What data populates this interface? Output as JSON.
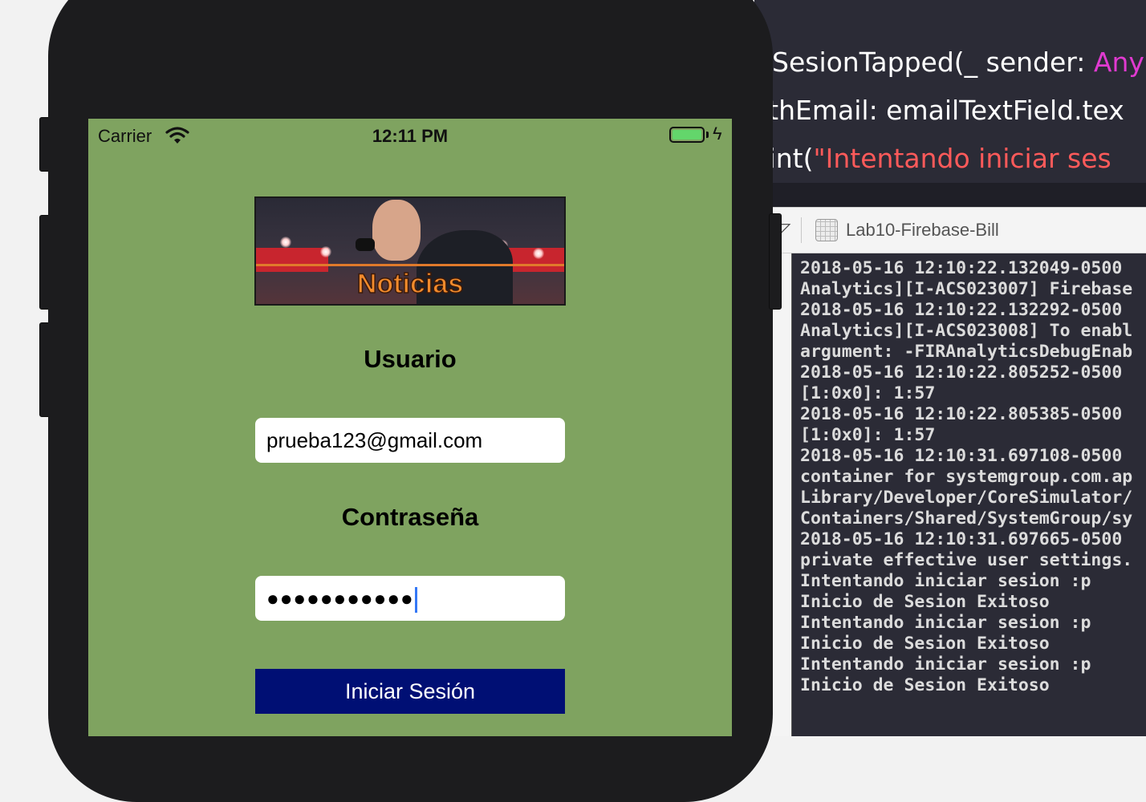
{
  "editor": {
    "line1": {
      "pre": "SesionTapped(_ sender: ",
      "type": "Any"
    },
    "line2": "ithEmail: emailTextField.tex",
    "line3": {
      "pre": "rint(",
      "str": "\"Intentando iniciar ses"
    }
  },
  "debug_bar": {
    "target_name": "Lab10-Firebase-Bill",
    "target_icon": "app-target-icon"
  },
  "console": {
    "lines": [
      "2018-05-16 12:10:22.132049-0500",
      "Analytics][I-ACS023007] Firebase",
      "2018-05-16 12:10:22.132292-0500",
      "Analytics][I-ACS023008] To enabl",
      "argument: -FIRAnalyticsDebugEnab",
      "2018-05-16 12:10:22.805252-0500",
      "[1:0x0]: 1:57",
      "2018-05-16 12:10:22.805385-0500",
      "[1:0x0]: 1:57",
      "2018-05-16 12:10:31.697108-0500",
      "container for systemgroup.com.ap",
      "Library/Developer/CoreSimulator/",
      "Containers/Shared/SystemGroup/sy",
      "2018-05-16 12:10:31.697665-0500",
      "private effective user settings.",
      "Intentando iniciar sesion :p",
      "Inicio de Sesion Exitoso",
      "Intentando iniciar sesion :p",
      "Inicio de Sesion Exitoso",
      "Intentando iniciar sesion :p",
      "Inicio de Sesion Exitoso"
    ]
  },
  "status_bar": {
    "carrier": "Carrier",
    "time": "12:11 PM",
    "battery_level": 1.0,
    "charging": true
  },
  "app": {
    "banner_title": "Noticias",
    "user_label": "Usuario",
    "email_value": "prueba123@gmail.com",
    "password_label": "Contraseña",
    "password_masked": "●●●●●●●●●●●",
    "login_button": "Iniciar Sesión"
  },
  "colors": {
    "screen_bg": "#7fa360",
    "button_bg": "#000f74",
    "editor_bg": "#2b2b36"
  }
}
